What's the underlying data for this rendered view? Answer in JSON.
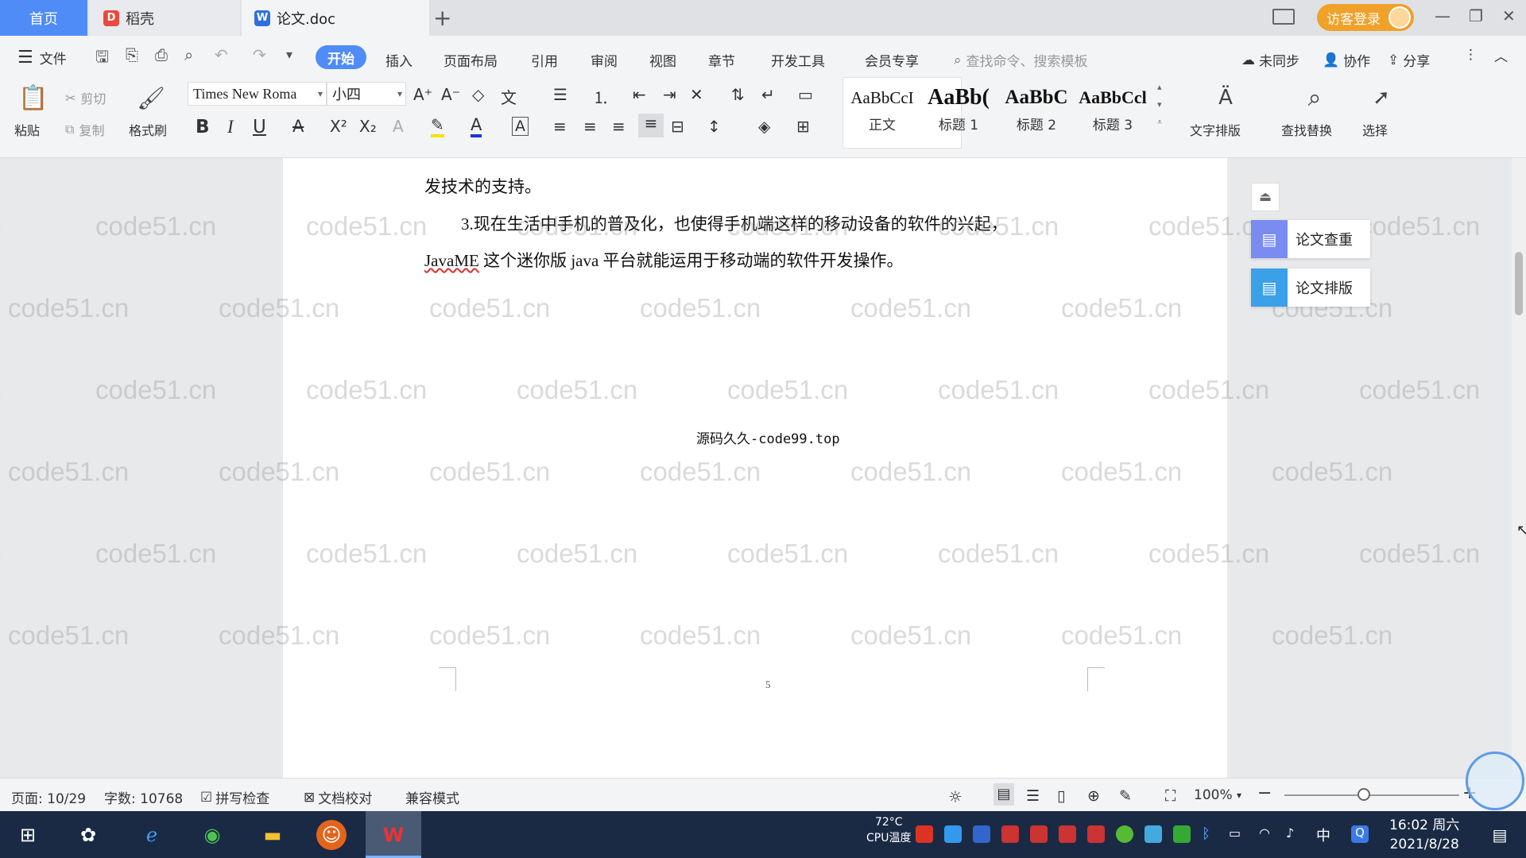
{
  "tabs": {
    "home": "首页",
    "daoke": "稻壳",
    "doc": "论文.doc",
    "add": "+"
  },
  "header": {
    "login": "访客登录",
    "minimize": "—",
    "restore": "❐",
    "close": "✕"
  },
  "menu": {
    "file": "文件",
    "start": "开始",
    "insert": "插入",
    "layout": "页面布局",
    "references": "引用",
    "review": "审阅",
    "view": "视图",
    "chapter": "章节",
    "devtools": "开发工具",
    "member": "会员专享",
    "search_placeholder": "查找命令、搜索模板",
    "sync": "未同步",
    "collab": "协作",
    "share": "分享"
  },
  "ribbon": {
    "paste": "粘贴",
    "cut": "剪切",
    "copy": "复制",
    "format_painter": "格式刷",
    "font_name": "Times New Roma",
    "font_size": "小四",
    "bold": "B",
    "italic": "I",
    "underline": "U",
    "styles": [
      {
        "preview": "AaBbCcI",
        "name": "正文"
      },
      {
        "preview": "AaBb(",
        "name": "标题 1"
      },
      {
        "preview": "AaBbC",
        "name": "标题 2"
      },
      {
        "preview": "AaBbCcl",
        "name": "标题 3"
      }
    ],
    "text_layout": "文字排版",
    "find_replace": "查找替换",
    "select": "选择"
  },
  "document": {
    "line1": "发技术的支持。",
    "line2": "3.现在生活中手机的普及化，也使得手机端这样的移动设备的软件的兴起，",
    "line3_a": "JavaME",
    "line3_b": " 这个迷你版 java 平台就能运用于移动端的软件开发操作。",
    "source": "源码久久-code99.top",
    "page_number": "5",
    "watermark": "code51.cn"
  },
  "side_panel": {
    "check": "论文查重",
    "format": "论文排版"
  },
  "status": {
    "page": "页面: 10/29",
    "words": "字数: 10768",
    "spell": "拼写检查",
    "proof": "文档校对",
    "compat": "兼容模式",
    "zoom": "100%"
  },
  "taskbar": {
    "cpu_temp": "72°C",
    "cpu_label": "CPU温度",
    "ime": "中",
    "time": "16:02 周六",
    "date": "2021/8/28"
  },
  "colors": {
    "accent": "#4f8cf7",
    "login": "#f0a12a",
    "taskbar": "#1a2a44"
  }
}
